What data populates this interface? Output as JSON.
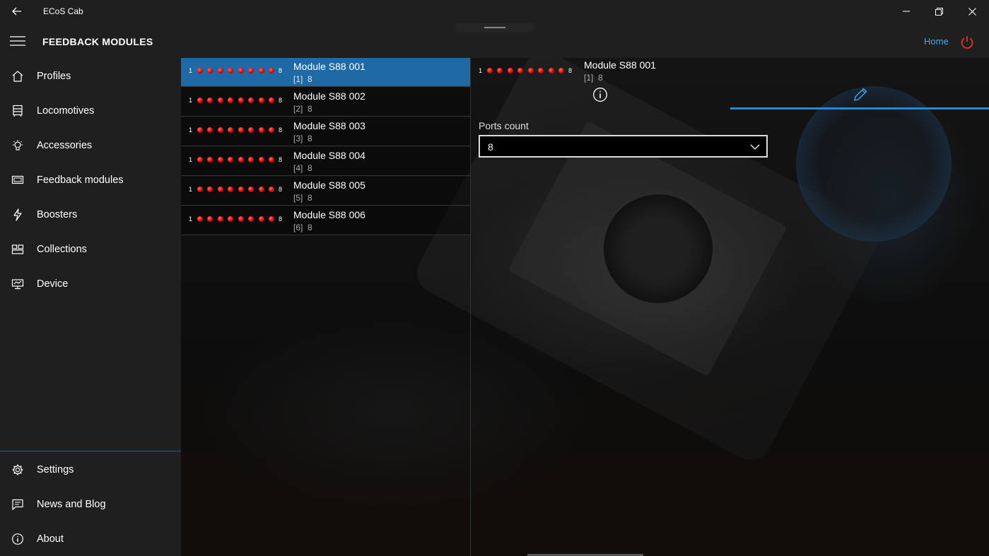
{
  "window": {
    "title": "ECoS Cab"
  },
  "header": {
    "page_title": "FEEDBACK MODULES",
    "home_label": "Home"
  },
  "sidebar": {
    "items": [
      {
        "label": "Profiles",
        "icon": "home-icon"
      },
      {
        "label": "Locomotives",
        "icon": "locomotive-icon"
      },
      {
        "label": "Accessories",
        "icon": "lightbulb-icon"
      },
      {
        "label": "Feedback modules",
        "icon": "feedback-module-icon"
      },
      {
        "label": "Boosters",
        "icon": "lightning-icon"
      },
      {
        "label": "Collections",
        "icon": "collections-icon"
      },
      {
        "label": "Device",
        "icon": "device-icon"
      }
    ],
    "bottom_items": [
      {
        "label": "Settings",
        "icon": "gear-icon"
      },
      {
        "label": "News and Blog",
        "icon": "news-icon"
      },
      {
        "label": "About",
        "icon": "info-icon"
      }
    ]
  },
  "modules": [
    {
      "name": "Module S88 001",
      "address": "[1]",
      "ports": "8",
      "led_start": "1",
      "led_end": "8",
      "selected": true
    },
    {
      "name": "Module S88 002",
      "address": "[2]",
      "ports": "8",
      "led_start": "1",
      "led_end": "8",
      "selected": false
    },
    {
      "name": "Module S88 003",
      "address": "[3]",
      "ports": "8",
      "led_start": "1",
      "led_end": "8",
      "selected": false
    },
    {
      "name": "Module S88 004",
      "address": "[4]",
      "ports": "8",
      "led_start": "1",
      "led_end": "8",
      "selected": false
    },
    {
      "name": "Module S88 005",
      "address": "[5]",
      "ports": "8",
      "led_start": "1",
      "led_end": "8",
      "selected": false
    },
    {
      "name": "Module S88 006",
      "address": "[6]",
      "ports": "8",
      "led_start": "1",
      "led_end": "8",
      "selected": false
    }
  ],
  "detail": {
    "name": "Module S88 001",
    "address": "[1]",
    "ports": "8",
    "led_start": "1",
    "led_end": "8",
    "ports_count_label": "Ports count",
    "ports_count_value": "8"
  },
  "colors": {
    "accent": "#1f6aa5",
    "link": "#4aa6e3",
    "power": "#e0352b",
    "led_on": "#d40000"
  }
}
